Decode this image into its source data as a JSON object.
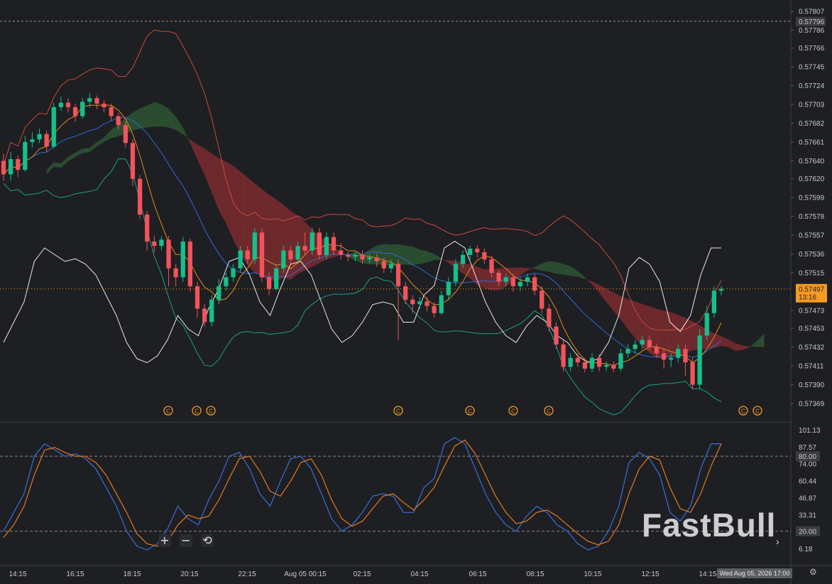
{
  "colors": {
    "background": "#1e1f23",
    "up": "#14c08a",
    "down": "#f2545b",
    "cloud_bear": "#8a2e32",
    "cloud_bull": "#2f5e35",
    "bb_upper": "#c94a3a",
    "bb_lower": "#1aa08a",
    "bb_mid": "#2e6ad6",
    "tenkan": "#e08a1e",
    "oscillator": "#ffffff",
    "stoch_k": "#3a6fd8",
    "stoch_d": "#e57a1c",
    "price_tag": "#f59a23"
  },
  "price_axis": {
    "labels": [
      "0.57807",
      "0.57796",
      "0.57786",
      "0.57766",
      "0.57745",
      "0.57724",
      "0.57703",
      "0.57682",
      "0.57661",
      "0.57640",
      "0.57620",
      "0.57599",
      "0.57578",
      "0.57557",
      "0.57536",
      "0.57515",
      "0.57497",
      "0.57473",
      "0.57453",
      "0.57432",
      "0.57411",
      "0.57390",
      "0.57369"
    ],
    "dashed_level": "0.57796",
    "current_price": "0.57497",
    "countdown": "13:16"
  },
  "stoch_axis": {
    "labels": [
      "101.13",
      "87.57",
      "80.00",
      "74.00",
      "60.44",
      "46.87",
      "33.31",
      "20.00",
      "6.18"
    ],
    "upper_level": "80.00",
    "lower_level": "20.00"
  },
  "time_axis": {
    "labels": [
      "14:15",
      "16:15",
      "18:15",
      "20:15",
      "22:15",
      "Aug 05 00:15",
      "02:15",
      "04:15",
      "06:15",
      "08:15",
      "10:15",
      "12:15",
      "14:15"
    ]
  },
  "crosshair_time": "Wed Aug 05, 2026 17:00",
  "watermark": "FastBull",
  "controls": {
    "zoom_in": "+",
    "zoom_out": "−",
    "reset": "⟲"
  },
  "event_marker_glyph": "C",
  "chart_data": {
    "type": "candlestick",
    "title": "",
    "ylim": [
      0.57369,
      0.57807
    ],
    "candles": [
      [
        0.5764,
        0.57625,
        0.57648,
        0.57618
      ],
      [
        0.57625,
        0.57642,
        0.5765,
        0.57618
      ],
      [
        0.57642,
        0.5763,
        0.57646,
        0.57622
      ],
      [
        0.5763,
        0.57661,
        0.57668,
        0.57628
      ],
      [
        0.57661,
        0.57664,
        0.57672,
        0.57655
      ],
      [
        0.57664,
        0.5767,
        0.57676,
        0.5766
      ],
      [
        0.5767,
        0.57656,
        0.57674,
        0.5765
      ],
      [
        0.57656,
        0.577,
        0.57705,
        0.57654
      ],
      [
        0.577,
        0.57705,
        0.57712,
        0.57696
      ],
      [
        0.57705,
        0.577,
        0.5771,
        0.57694
      ],
      [
        0.577,
        0.5769,
        0.57704,
        0.57684
      ],
      [
        0.5769,
        0.57706,
        0.5771,
        0.57687
      ],
      [
        0.57706,
        0.5771,
        0.57716,
        0.577
      ],
      [
        0.5771,
        0.57704,
        0.57713,
        0.57698
      ],
      [
        0.57704,
        0.577,
        0.57708,
        0.57694
      ],
      [
        0.577,
        0.5769,
        0.57704,
        0.57685
      ],
      [
        0.5769,
        0.5768,
        0.57694,
        0.57675
      ],
      [
        0.5768,
        0.5766,
        0.57684,
        0.57655
      ],
      [
        0.5766,
        0.5762,
        0.57664,
        0.57612
      ],
      [
        0.5762,
        0.5758,
        0.57624,
        0.57575
      ],
      [
        0.5758,
        0.5755,
        0.57584,
        0.5754
      ],
      [
        0.5755,
        0.57545,
        0.57556,
        0.57538
      ],
      [
        0.57545,
        0.57552,
        0.57556,
        0.5754
      ],
      [
        0.57552,
        0.5752,
        0.57556,
        0.575
      ],
      [
        0.5752,
        0.5751,
        0.57525,
        0.575
      ],
      [
        0.5751,
        0.5755,
        0.57555,
        0.57505
      ],
      [
        0.5755,
        0.575,
        0.57553,
        0.57494
      ],
      [
        0.575,
        0.57475,
        0.57505,
        0.57465
      ],
      [
        0.57475,
        0.5746,
        0.5748,
        0.57455
      ],
      [
        0.5746,
        0.57485,
        0.5749,
        0.57455
      ],
      [
        0.57485,
        0.575,
        0.57508,
        0.5748
      ],
      [
        0.575,
        0.5751,
        0.57515,
        0.57495
      ],
      [
        0.5751,
        0.5752,
        0.57525,
        0.57505
      ],
      [
        0.5752,
        0.5754,
        0.57545,
        0.57515
      ],
      [
        0.5754,
        0.5753,
        0.57545,
        0.57525
      ],
      [
        0.5753,
        0.5756,
        0.57565,
        0.57525
      ],
      [
        0.5756,
        0.5751,
        0.57565,
        0.57505
      ],
      [
        0.5751,
        0.57497,
        0.57515,
        0.5749
      ],
      [
        0.57497,
        0.5752,
        0.57525,
        0.57495
      ],
      [
        0.5752,
        0.5754,
        0.57545,
        0.57515
      ],
      [
        0.5754,
        0.5753,
        0.57545,
        0.57525
      ],
      [
        0.5753,
        0.57545,
        0.5755,
        0.57525
      ],
      [
        0.57545,
        0.5754,
        0.5756,
        0.57535
      ],
      [
        0.5754,
        0.5756,
        0.57565,
        0.57535
      ],
      [
        0.5756,
        0.57535,
        0.57565,
        0.5753
      ],
      [
        0.57535,
        0.57555,
        0.5756,
        0.5753
      ],
      [
        0.57555,
        0.5754,
        0.5756,
        0.57535
      ],
      [
        0.5754,
        0.57535,
        0.57548,
        0.5753
      ],
      [
        0.57535,
        0.57533,
        0.57538,
        0.57528
      ],
      [
        0.57533,
        0.57535,
        0.57538,
        0.57528
      ],
      [
        0.57535,
        0.5753,
        0.5754,
        0.57525
      ],
      [
        0.5753,
        0.57532,
        0.57536,
        0.57526
      ],
      [
        0.57532,
        0.57528,
        0.57536,
        0.57522
      ],
      [
        0.57528,
        0.5752,
        0.57532,
        0.57515
      ],
      [
        0.5752,
        0.57525,
        0.5753,
        0.57515
      ],
      [
        0.57525,
        0.575,
        0.5753,
        0.5744
      ],
      [
        0.575,
        0.57485,
        0.57505,
        0.5748
      ],
      [
        0.57485,
        0.5748,
        0.5749,
        0.5747
      ],
      [
        0.5748,
        0.57483,
        0.57488,
        0.57475
      ],
      [
        0.57483,
        0.57478,
        0.57488,
        0.57472
      ],
      [
        0.57478,
        0.5747,
        0.57482,
        0.57465
      ],
      [
        0.5747,
        0.5749,
        0.57495,
        0.57468
      ],
      [
        0.5749,
        0.57505,
        0.5751,
        0.57485
      ],
      [
        0.57505,
        0.57525,
        0.5753,
        0.575
      ],
      [
        0.57525,
        0.57535,
        0.5754,
        0.5752
      ],
      [
        0.57535,
        0.57542,
        0.57545,
        0.5753
      ],
      [
        0.57542,
        0.57538,
        0.57546,
        0.57532
      ],
      [
        0.57538,
        0.5753,
        0.57542,
        0.57525
      ],
      [
        0.5753,
        0.57515,
        0.57534,
        0.5751
      ],
      [
        0.57515,
        0.57505,
        0.57518,
        0.575
      ],
      [
        0.57505,
        0.5751,
        0.57514,
        0.575
      ],
      [
        0.5751,
        0.575,
        0.57514,
        0.57494
      ],
      [
        0.575,
        0.57505,
        0.5751,
        0.57495
      ],
      [
        0.57505,
        0.5751,
        0.57514,
        0.575
      ],
      [
        0.5751,
        0.57495,
        0.57514,
        0.5749
      ],
      [
        0.57495,
        0.57475,
        0.575,
        0.5747
      ],
      [
        0.57475,
        0.57455,
        0.5748,
        0.5745
      ],
      [
        0.57455,
        0.57435,
        0.5746,
        0.5743
      ],
      [
        0.57435,
        0.5741,
        0.5744,
        0.57405
      ],
      [
        0.5741,
        0.5742,
        0.57425,
        0.57405
      ],
      [
        0.5742,
        0.57415,
        0.57425,
        0.5741
      ],
      [
        0.57415,
        0.57408,
        0.5742,
        0.57404
      ],
      [
        0.57408,
        0.5742,
        0.57425,
        0.57404
      ],
      [
        0.5742,
        0.5741,
        0.57424,
        0.57405
      ],
      [
        0.5741,
        0.57412,
        0.57416,
        0.57406
      ],
      [
        0.57412,
        0.57408,
        0.57416,
        0.57404
      ],
      [
        0.57408,
        0.57425,
        0.5743,
        0.57405
      ],
      [
        0.57425,
        0.5743,
        0.57435,
        0.5742
      ],
      [
        0.5743,
        0.57435,
        0.5744,
        0.57425
      ],
      [
        0.57435,
        0.5744,
        0.57445,
        0.5743
      ],
      [
        0.5744,
        0.57432,
        0.57445,
        0.57428
      ],
      [
        0.57432,
        0.57425,
        0.57436,
        0.5742
      ],
      [
        0.57425,
        0.57418,
        0.5743,
        0.57408
      ],
      [
        0.57418,
        0.5742,
        0.57425,
        0.5741
      ],
      [
        0.5742,
        0.5743,
        0.57435,
        0.57415
      ],
      [
        0.5743,
        0.57415,
        0.57435,
        0.574
      ],
      [
        0.57415,
        0.5739,
        0.5742,
        0.57385
      ],
      [
        0.5739,
        0.57445,
        0.57452,
        0.57385
      ],
      [
        0.57445,
        0.5747,
        0.57478,
        0.5744
      ],
      [
        0.5747,
        0.57495,
        0.575,
        0.57465
      ],
      [
        0.57495,
        0.57497,
        0.575,
        0.5749
      ]
    ],
    "stochastic": {
      "k": [
        20,
        35,
        50,
        80,
        90,
        85,
        80,
        82,
        78,
        70,
        55,
        40,
        20,
        8,
        5,
        10,
        22,
        40,
        30,
        25,
        45,
        60,
        80,
        83,
        70,
        50,
        40,
        60,
        78,
        80,
        70,
        50,
        30,
        20,
        25,
        35,
        48,
        50,
        48,
        35,
        35,
        55,
        62,
        90,
        95,
        90,
        70,
        50,
        35,
        25,
        20,
        32,
        40,
        35,
        25,
        20,
        10,
        5,
        8,
        20,
        40,
        75,
        83,
        78,
        65,
        35,
        28,
        40,
        70,
        90,
        90
      ],
      "d": [
        15,
        25,
        40,
        65,
        85,
        87,
        83,
        80,
        80,
        75,
        65,
        50,
        35,
        18,
        10,
        8,
        12,
        25,
        33,
        30,
        32,
        45,
        62,
        78,
        80,
        68,
        52,
        48,
        60,
        75,
        78,
        65,
        45,
        30,
        24,
        28,
        38,
        48,
        50,
        43,
        37,
        45,
        55,
        72,
        88,
        93,
        82,
        65,
        48,
        35,
        26,
        28,
        35,
        37,
        32,
        25,
        18,
        12,
        9,
        12,
        25,
        50,
        70,
        80,
        77,
        55,
        38,
        35,
        50,
        72,
        90
      ]
    }
  }
}
